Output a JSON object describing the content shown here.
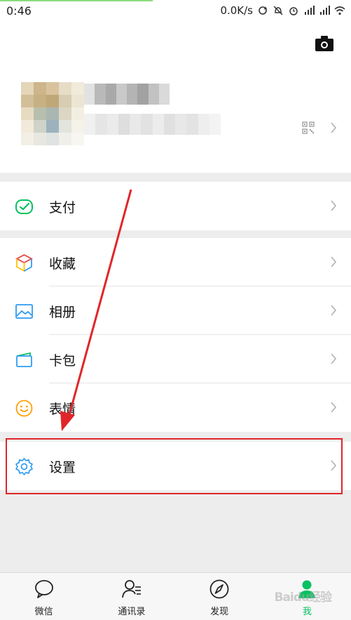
{
  "status_bar": {
    "time": "0:46",
    "network_speed": "0.0K/s"
  },
  "menu": {
    "pay": {
      "label": "支付"
    },
    "favorites": {
      "label": "收藏"
    },
    "album": {
      "label": "相册"
    },
    "cards": {
      "label": "卡包"
    },
    "stickers": {
      "label": "表情"
    },
    "settings": {
      "label": "设置"
    }
  },
  "tabbar": {
    "chats": "微信",
    "contacts": "通讯录",
    "discover": "发现",
    "me": "我",
    "active": "me"
  },
  "colors": {
    "accent_green": "#07c160",
    "highlight_red": "#e0262a",
    "background": "#ededed"
  },
  "icons": {
    "camera": "camera-icon",
    "qr": "qr-code-icon",
    "pay": "wallet-check-icon",
    "favorites": "cube-icon",
    "album": "picture-icon",
    "cards": "card-icon",
    "stickers": "smiley-icon",
    "settings": "gear-icon"
  },
  "watermark": "Baidu经验"
}
